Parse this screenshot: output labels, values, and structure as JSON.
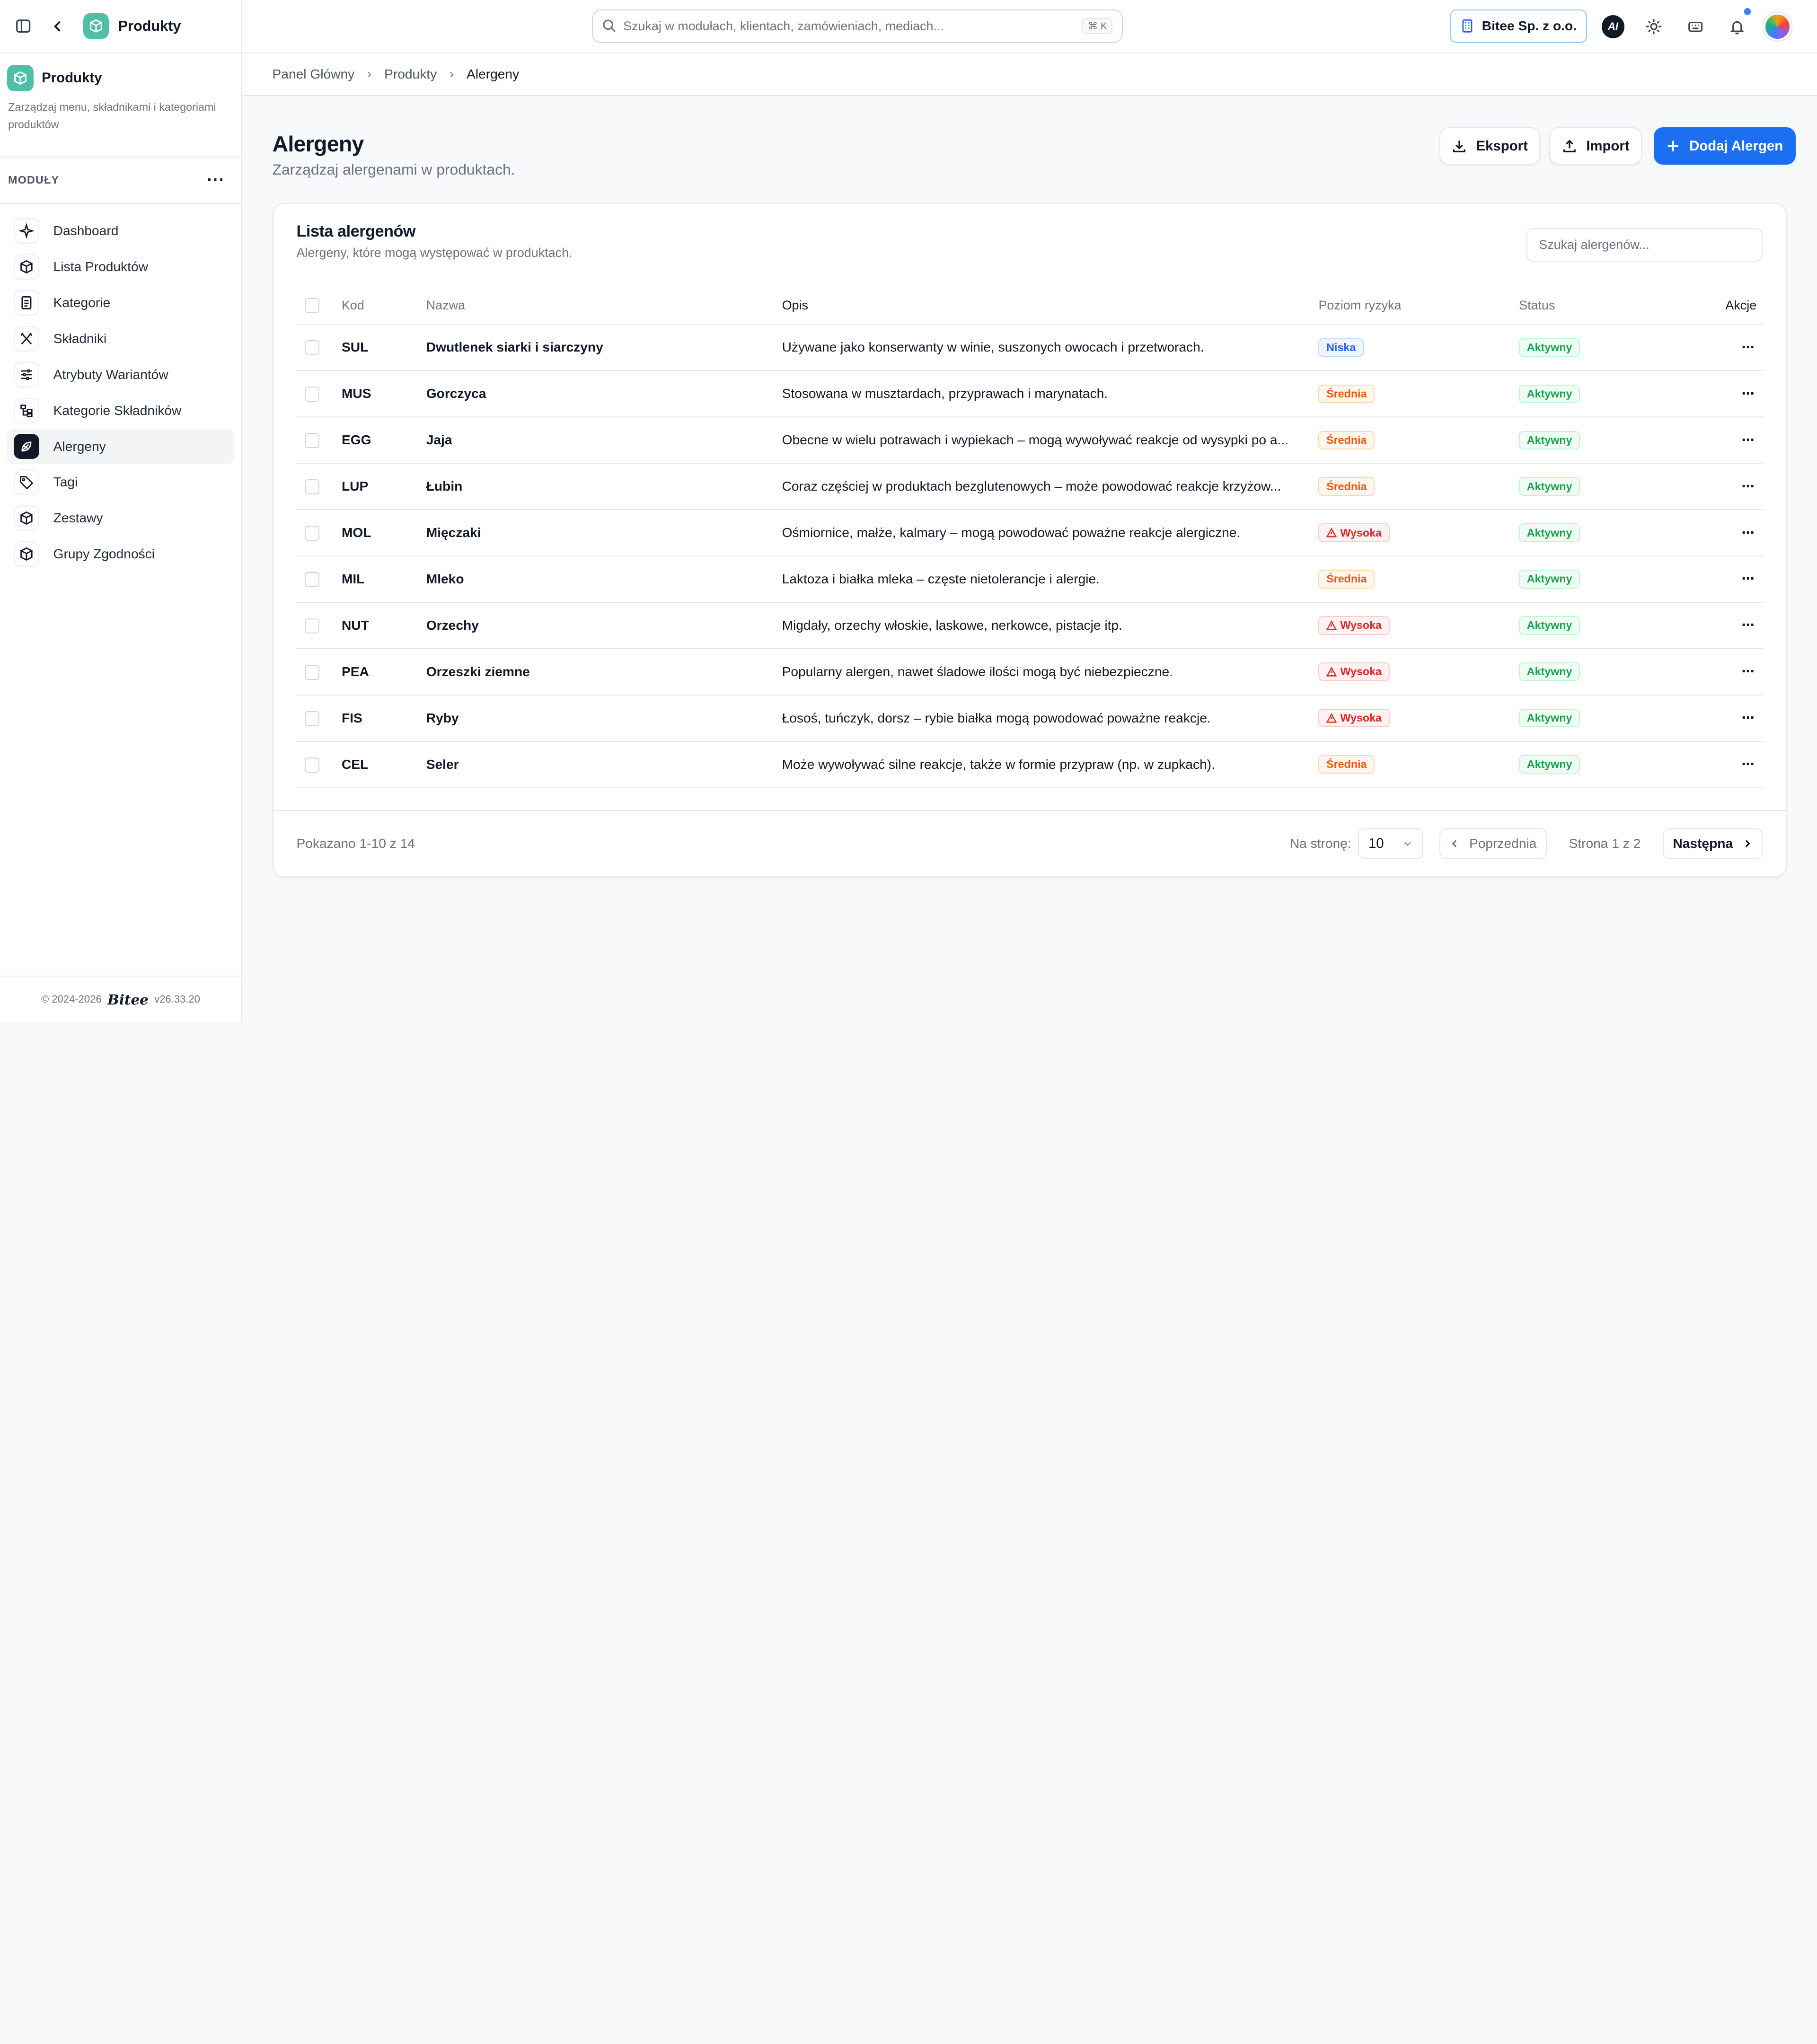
{
  "sidebar": {
    "app_name": "Produkty",
    "module_title": "Produkty",
    "module_desc": "Zarządzaj menu, składnikami i kategoriami produktów",
    "modules_label": "MODUŁY",
    "items": [
      {
        "label": "Dashboard",
        "icon": "sparkles-icon",
        "active": false
      },
      {
        "label": "Lista Produktów",
        "icon": "cube-icon",
        "active": false
      },
      {
        "label": "Kategorie",
        "icon": "document-icon",
        "active": false
      },
      {
        "label": "Składniki",
        "icon": "utensils-icon",
        "active": false
      },
      {
        "label": "Atrybuty Wariantów",
        "icon": "sliders-icon",
        "active": false
      },
      {
        "label": "Kategorie Składników",
        "icon": "tree-icon",
        "active": false
      },
      {
        "label": "Alergeny",
        "icon": "allergen-icon",
        "active": true
      },
      {
        "label": "Tagi",
        "icon": "tag-icon",
        "active": false
      },
      {
        "label": "Zestawy",
        "icon": "cube-icon",
        "active": false
      },
      {
        "label": "Grupy Zgodności",
        "icon": "cube-icon",
        "active": false
      }
    ],
    "footer_copyright": "© 2024-2026",
    "footer_logo": "Bitee",
    "footer_version": "v26.33.20"
  },
  "topbar": {
    "search_placeholder": "Szukaj w modułach, klientach, zamówieniach, mediach...",
    "search_shortcut": "⌘ K",
    "org_name": "Bitee Sp. z o.o.",
    "ai_label": "AI"
  },
  "breadcrumb": [
    "Panel Główny",
    "Produkty",
    "Alergeny"
  ],
  "page": {
    "title": "Alergeny",
    "subtitle": "Zarządzaj alergenami w produktach.",
    "export_label": "Eksport",
    "import_label": "Import",
    "add_label": "Dodaj Alergen"
  },
  "card": {
    "title": "Lista alergenów",
    "subtitle": "Alergeny, które mogą występować w produktach.",
    "search_placeholder": "Szukaj alergenów..."
  },
  "table": {
    "columns": [
      "Kod",
      "Nazwa",
      "Opis",
      "Poziom ryzyka",
      "Status",
      "Akcje"
    ],
    "rows": [
      {
        "code": "SUL",
        "name": "Dwutlenek siarki i siarczyny",
        "desc": "Używane jako konserwanty w winie, suszonych owocach i przetworach.",
        "risk": "Niska",
        "risk_level": "low",
        "status": "Aktywny"
      },
      {
        "code": "MUS",
        "name": "Gorczyca",
        "desc": "Stosowana w musztardach, przyprawach i marynatach.",
        "risk": "Średnia",
        "risk_level": "mid",
        "status": "Aktywny"
      },
      {
        "code": "EGG",
        "name": "Jaja",
        "desc": "Obecne w wielu potrawach i wypiekach – mogą wywoływać reakcje od wysypki po a...",
        "risk": "Średnia",
        "risk_level": "mid",
        "status": "Aktywny"
      },
      {
        "code": "LUP",
        "name": "Łubin",
        "desc": "Coraz częściej w produktach bezglutenowych – może powodować reakcje krzyżow...",
        "risk": "Średnia",
        "risk_level": "mid",
        "status": "Aktywny"
      },
      {
        "code": "MOL",
        "name": "Mięczaki",
        "desc": "Ośmiornice, małże, kalmary – mogą powodować poważne reakcje alergiczne.",
        "risk": "Wysoka",
        "risk_level": "high",
        "status": "Aktywny"
      },
      {
        "code": "MIL",
        "name": "Mleko",
        "desc": "Laktoza i białka mleka – częste nietolerancje i alergie.",
        "risk": "Średnia",
        "risk_level": "mid",
        "status": "Aktywny"
      },
      {
        "code": "NUT",
        "name": "Orzechy",
        "desc": "Migdały, orzechy włoskie, laskowe, nerkowce, pistacje itp.",
        "risk": "Wysoka",
        "risk_level": "high",
        "status": "Aktywny"
      },
      {
        "code": "PEA",
        "name": "Orzeszki ziemne",
        "desc": "Popularny alergen, nawet śladowe ilości mogą być niebezpieczne.",
        "risk": "Wysoka",
        "risk_level": "high",
        "status": "Aktywny"
      },
      {
        "code": "FIS",
        "name": "Ryby",
        "desc": "Łosoś, tuńczyk, dorsz – rybie białka mogą powodować poważne reakcje.",
        "risk": "Wysoka",
        "risk_level": "high",
        "status": "Aktywny"
      },
      {
        "code": "CEL",
        "name": "Seler",
        "desc": "Może wywoływać silne reakcje, także w formie przypraw (np. w zupkach).",
        "risk": "Średnia",
        "risk_level": "mid",
        "status": "Aktywny"
      }
    ]
  },
  "footer": {
    "shown": "Pokazano 1-10 z 14",
    "per_page_label": "Na stronę:",
    "per_page_value": "10",
    "prev_label": "Poprzednia",
    "page_info": "Strona 1 z 2",
    "next_label": "Następna"
  },
  "colors": {
    "accent": "#1d6ff2",
    "app_badge": "#4fbfa8",
    "risk_low": "#2563eb",
    "risk_mid": "#ea580c",
    "risk_high": "#dc2626",
    "status_active": "#16a34a"
  }
}
